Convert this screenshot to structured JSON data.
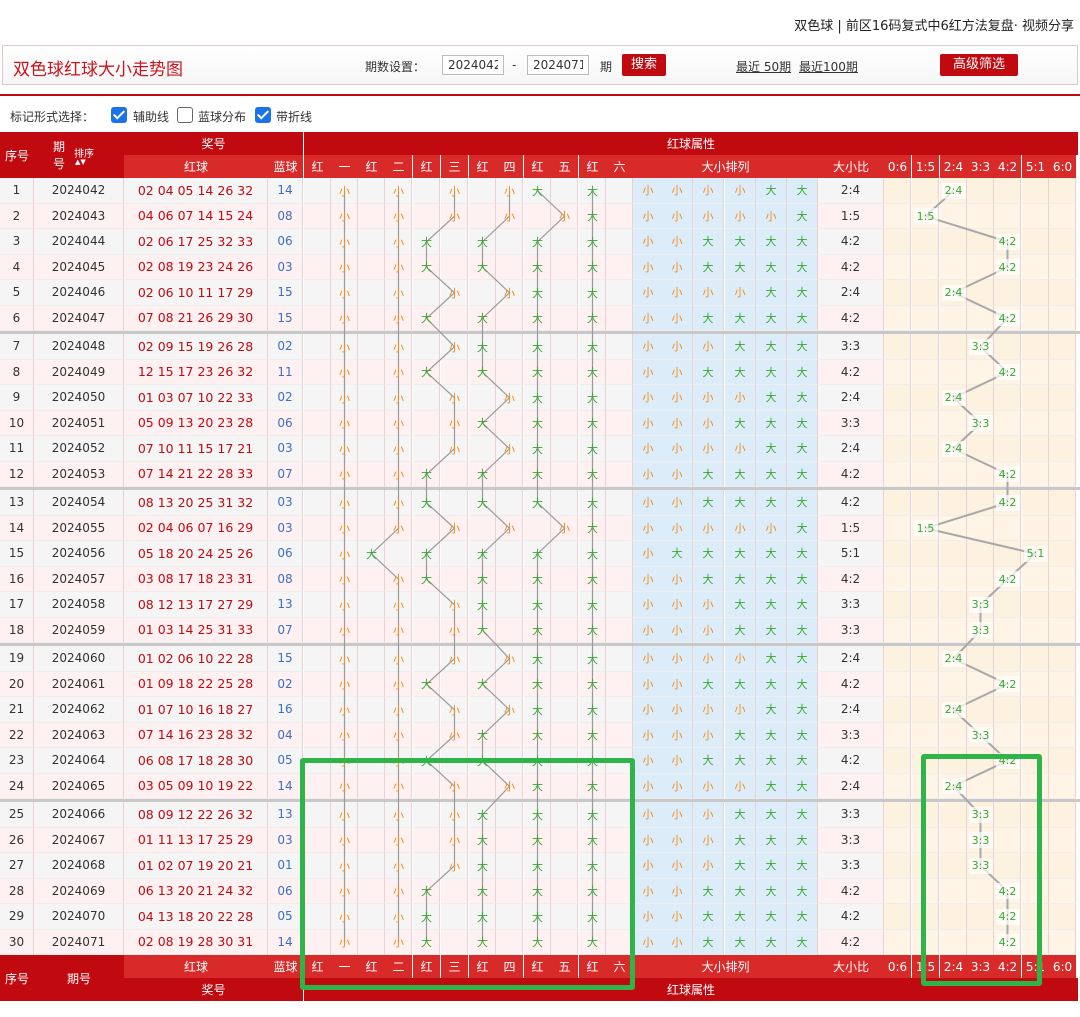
{
  "top_caption": "双色球 | 前区16码复式中6红方法复盘· 视频分享",
  "page_title": "双色球红球大小走势图",
  "period_settings": {
    "label": "期数设置：",
    "from": "2024042",
    "dash": "-",
    "to": "2024071",
    "unit": "期",
    "search_label": "搜索"
  },
  "recent_links": [
    "最近 50期",
    "最近100期"
  ],
  "advanced_filter_label": "高级筛选",
  "mark_form": {
    "label": "标记形式选择：",
    "options": [
      {
        "label": "辅助线",
        "checked": true
      },
      {
        "label": "蓝球分布",
        "checked": false
      },
      {
        "label": "带折线",
        "checked": true
      }
    ]
  },
  "headers": {
    "seq": "序号",
    "period_top": "期",
    "period_bottom": "号",
    "sort": "排序",
    "prize_number": "奖号",
    "red_ball": "红球",
    "blue_ball": "蓝球",
    "red_attr": "红球属性",
    "positions": [
      "红",
      "一",
      "红",
      "二",
      "红",
      "三",
      "红",
      "四",
      "红",
      "五",
      "红",
      "六"
    ],
    "size_order": "大小排列",
    "size_ratio": "大小比",
    "ratios": [
      "0:6",
      "1:5",
      "2:4",
      "3:3",
      "4:2",
      "5:1",
      "6:0"
    ],
    "footer_period": "期号"
  },
  "colors": {
    "header_red": "#c00a10",
    "small": "#f08c1e",
    "big": "#36a82e",
    "blue": "#3b6fc4",
    "highlight": "#2fb44a"
  },
  "rows": [
    {
      "seq": "1",
      "period": "2024042",
      "reds": "02 04 05 14 26 32",
      "blue": "14",
      "pattern": "小小小小大大",
      "ratio": "2:4"
    },
    {
      "seq": "2",
      "period": "2024043",
      "reds": "04 06 07 14 15 24",
      "blue": "08",
      "pattern": "小小小小小大",
      "ratio": "1:5"
    },
    {
      "seq": "3",
      "period": "2024044",
      "reds": "02 06 17 25 32 33",
      "blue": "06",
      "pattern": "小小大大大大",
      "ratio": "4:2"
    },
    {
      "seq": "4",
      "period": "2024045",
      "reds": "02 08 19 23 24 26",
      "blue": "03",
      "pattern": "小小大大大大",
      "ratio": "4:2"
    },
    {
      "seq": "5",
      "period": "2024046",
      "reds": "02 06 10 11 17 29",
      "blue": "15",
      "pattern": "小小小小大大",
      "ratio": "2:4"
    },
    {
      "seq": "6",
      "period": "2024047",
      "reds": "07 08 21 26 29 30",
      "blue": "15",
      "pattern": "小小大大大大",
      "ratio": "4:2"
    },
    {
      "seq": "7",
      "period": "2024048",
      "reds": "02 09 15 19 26 28",
      "blue": "02",
      "pattern": "小小小大大大",
      "ratio": "3:3"
    },
    {
      "seq": "8",
      "period": "2024049",
      "reds": "12 15 17 23 26 32",
      "blue": "11",
      "pattern": "小小大大大大",
      "ratio": "4:2"
    },
    {
      "seq": "9",
      "period": "2024050",
      "reds": "01 03 07 10 22 33",
      "blue": "02",
      "pattern": "小小小小大大",
      "ratio": "2:4"
    },
    {
      "seq": "10",
      "period": "2024051",
      "reds": "05 09 13 20 23 28",
      "blue": "06",
      "pattern": "小小小大大大",
      "ratio": "3:3"
    },
    {
      "seq": "11",
      "period": "2024052",
      "reds": "07 10 11 15 17 21",
      "blue": "03",
      "pattern": "小小小小大大",
      "ratio": "2:4"
    },
    {
      "seq": "12",
      "period": "2024053",
      "reds": "07 14 21 22 28 33",
      "blue": "07",
      "pattern": "小小大大大大",
      "ratio": "4:2"
    },
    {
      "seq": "13",
      "period": "2024054",
      "reds": "08 13 20 25 31 32",
      "blue": "03",
      "pattern": "小小大大大大",
      "ratio": "4:2"
    },
    {
      "seq": "14",
      "period": "2024055",
      "reds": "02 04 06 07 16 29",
      "blue": "03",
      "pattern": "小小小小小大",
      "ratio": "1:5"
    },
    {
      "seq": "15",
      "period": "2024056",
      "reds": "05 18 20 24 25 26",
      "blue": "06",
      "pattern": "小大大大大大",
      "ratio": "5:1"
    },
    {
      "seq": "16",
      "period": "2024057",
      "reds": "03 08 17 18 23 31",
      "blue": "08",
      "pattern": "小小大大大大",
      "ratio": "4:2"
    },
    {
      "seq": "17",
      "period": "2024058",
      "reds": "08 12 13 17 27 29",
      "blue": "13",
      "pattern": "小小小大大大",
      "ratio": "3:3"
    },
    {
      "seq": "18",
      "period": "2024059",
      "reds": "01 03 14 25 31 33",
      "blue": "07",
      "pattern": "小小小大大大",
      "ratio": "3:3"
    },
    {
      "seq": "19",
      "period": "2024060",
      "reds": "01 02 06 10 22 28",
      "blue": "15",
      "pattern": "小小小小大大",
      "ratio": "2:4"
    },
    {
      "seq": "20",
      "period": "2024061",
      "reds": "01 09 18 22 25 28",
      "blue": "02",
      "pattern": "小小大大大大",
      "ratio": "4:2"
    },
    {
      "seq": "21",
      "period": "2024062",
      "reds": "01 07 10 16 18 27",
      "blue": "16",
      "pattern": "小小小小大大",
      "ratio": "2:4"
    },
    {
      "seq": "22",
      "period": "2024063",
      "reds": "07 14 16 23 28 32",
      "blue": "04",
      "pattern": "小小小大大大",
      "ratio": "3:3"
    },
    {
      "seq": "23",
      "period": "2024064",
      "reds": "06 08 17 18 28 30",
      "blue": "05",
      "pattern": "小小大大大大",
      "ratio": "4:2"
    },
    {
      "seq": "24",
      "period": "2024065",
      "reds": "03 05 09 10 19 22",
      "blue": "14",
      "pattern": "小小小小大大",
      "ratio": "2:4"
    },
    {
      "seq": "25",
      "period": "2024066",
      "reds": "08 09 12 22 26 32",
      "blue": "13",
      "pattern": "小小小大大大",
      "ratio": "3:3"
    },
    {
      "seq": "26",
      "period": "2024067",
      "reds": "01 11 13 17 25 29",
      "blue": "03",
      "pattern": "小小小大大大",
      "ratio": "3:3"
    },
    {
      "seq": "27",
      "period": "2024068",
      "reds": "01 02 07 19 20 21",
      "blue": "01",
      "pattern": "小小小大大大",
      "ratio": "3:3"
    },
    {
      "seq": "28",
      "period": "2024069",
      "reds": "06 13 20 21 24 32",
      "blue": "06",
      "pattern": "小小大大大大",
      "ratio": "4:2"
    },
    {
      "seq": "29",
      "period": "2024070",
      "reds": "04 13 18 20 22 28",
      "blue": "05",
      "pattern": "小小大大大大",
      "ratio": "4:2"
    },
    {
      "seq": "30",
      "period": "2024071",
      "reds": "02 08 19 28 30 31",
      "blue": "14",
      "pattern": "小小大大大大",
      "ratio": "4:2"
    }
  ],
  "small_label": "小",
  "big_label": "大"
}
